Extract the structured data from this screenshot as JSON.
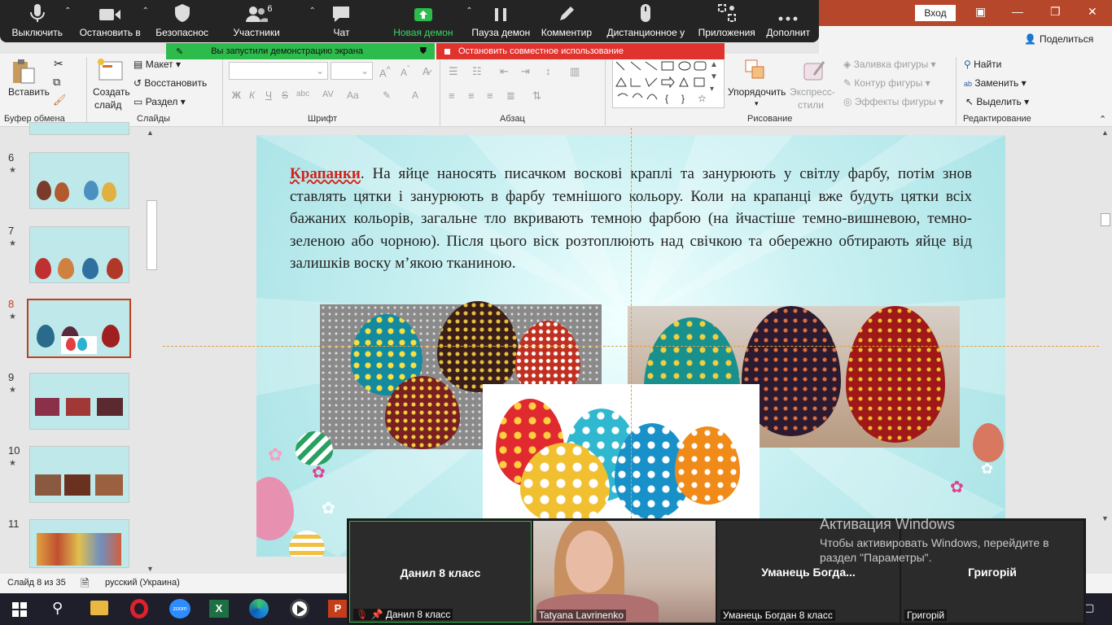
{
  "zoom_toolbar": {
    "mute": "Выключить",
    "video": "Остановить в",
    "security": "Безопаснос",
    "participants": "Участники",
    "participants_count": "6",
    "chat": "Чат",
    "new_share": "Новая демон",
    "pause_share": "Пауза демон",
    "annotate": "Комментир",
    "remote": "Дистанционное у",
    "apps": "Приложения",
    "more": "Дополнит"
  },
  "banners": {
    "sharing": "Вы запустили демонстрацию экрана",
    "stop": "Остановить совместное использование"
  },
  "titlebar": {
    "login": "Вход",
    "share": "Поделиться"
  },
  "ribbon": {
    "clipboard": {
      "paste": "Вставить",
      "group": "Буфер обмена"
    },
    "slides": {
      "new_slide": "Создать",
      "new_slide2": "слайд",
      "layout": "Макет",
      "reset": "Восстановить",
      "section": "Раздел",
      "group": "Слайды"
    },
    "font": {
      "group": "Шрифт",
      "bold": "Ж",
      "italic": "К",
      "underline": "Ч",
      "strike": "S",
      "shadow": "abc",
      "spacing": "AV",
      "case": "Aa",
      "color": "A"
    },
    "paragraph": {
      "group": "Абзац"
    },
    "drawing": {
      "arrange": "Упорядочить",
      "styles": "Экспресс-",
      "styles2": "стили",
      "fill": "Заливка фигуры",
      "outline": "Контур фигуры",
      "effects": "Эффекты фигуры",
      "group": "Рисование"
    },
    "editing": {
      "find": "Найти",
      "replace": "Заменить",
      "select": "Выделить",
      "group": "Редактирование"
    }
  },
  "thumbnails": [
    {
      "num": "6"
    },
    {
      "num": "7"
    },
    {
      "num": "8"
    },
    {
      "num": "9"
    },
    {
      "num": "10"
    },
    {
      "num": "11"
    }
  ],
  "slide": {
    "keyword": "Крапанки",
    "text": ". На яйце наносять писачком воскові краплі та занурюють у світлу фарбу, потім знов ставлять цятки і занурюють в фарбу темнішого кольору. Коли на крапанці вже будуть цятки всіх бажаних кольорів, загальне тло вкривають темною фарбою (на йчастіше темно-вишневою, темно-зеленою або чорною). Після цього віск розтоплюють над свічкою та обережно обтирають яйце від залишків воску м’якою тканиною."
  },
  "status": {
    "slide": "Слайд 8 из 35",
    "language": "русский (Украина)"
  },
  "videos": [
    {
      "name": "Данил 8 класс",
      "label": "Данил 8 класс"
    },
    {
      "name": "",
      "label": "Tatyana Lavrinenko"
    },
    {
      "name": "Уманець  Богда...",
      "label": "Уманець Богдан 8 класс"
    },
    {
      "name": "Григорій",
      "label": "Григорій"
    }
  ],
  "activation": {
    "title": "Активация Windows",
    "line1": "Чтобы активировать Windows, перейдите в",
    "line2": "раздел \"Параметры\"."
  },
  "colors": {
    "ppt_accent": "#b7472a",
    "zoom_bar": "#242424",
    "share_green": "#2dbb4c",
    "stop_red": "#e0332e"
  }
}
